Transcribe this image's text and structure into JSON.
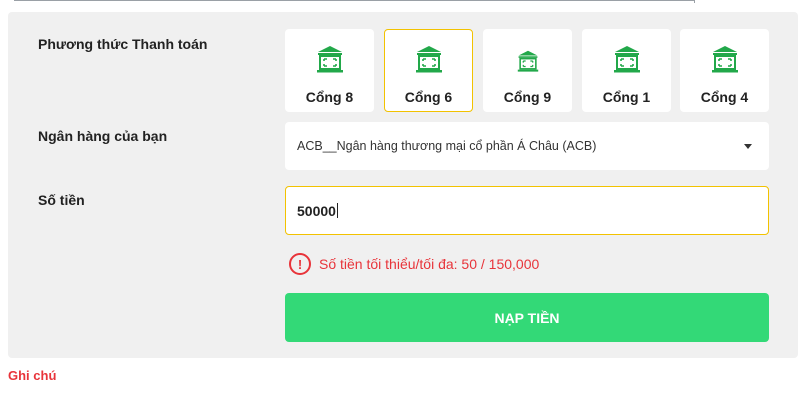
{
  "form": {
    "payment_method_label": "Phương thức Thanh toán",
    "bank_label": "Ngân hàng của bạn",
    "amount_label": "Số tiền"
  },
  "payment_methods": [
    {
      "label": "Cổng 8",
      "icon": "bank-icon",
      "selected": false
    },
    {
      "label": "Cổng 6",
      "icon": "bank-icon",
      "selected": true
    },
    {
      "label": "Cổng 9",
      "icon": "bank-icon",
      "selected": false
    },
    {
      "label": "Cổng 1",
      "icon": "bank-icon",
      "selected": false
    },
    {
      "label": "Cổng 4",
      "icon": "bank-icon",
      "selected": false
    }
  ],
  "bank_select": {
    "value": "ACB__Ngân hàng thương mại cổ phần Á Châu (ACB)"
  },
  "amount_input": {
    "value": "50000"
  },
  "amount_error": {
    "icon": "alert-circle-icon",
    "message": "Số tiền tối thiểu/tối đa: 50 / 150,000"
  },
  "submit_button": {
    "label": "NẠP TIỀN"
  },
  "note": {
    "label": "Ghi chú"
  },
  "colors": {
    "accent_green": "#33d977",
    "icon_green": "#22a84a",
    "selected_border": "#f2c200",
    "error_red": "#e8343a",
    "panel_bg": "#f0f0f0"
  }
}
